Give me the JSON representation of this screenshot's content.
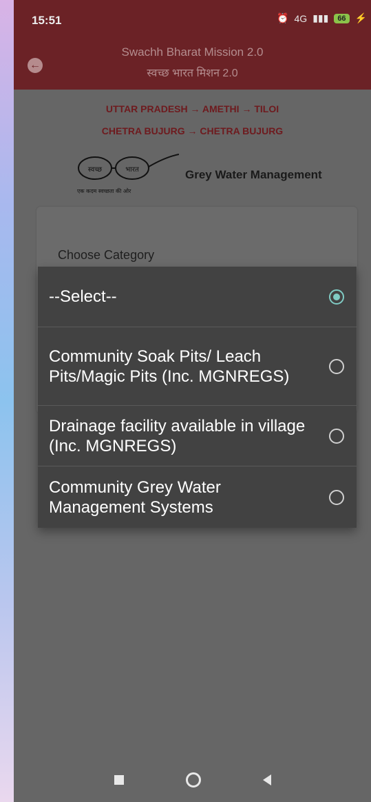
{
  "status": {
    "time": "15:51",
    "network": "4G",
    "battery": "66"
  },
  "header": {
    "title": "Swachh Bharat Mission 2.0",
    "subtitle": "स्वच्छ भारत मिशन 2.0"
  },
  "breadcrumb": {
    "line1": "UTTAR PRADESH → AMETHI → TILOI",
    "line2": "CHETRA BUJURG → CHETRA BUJURG"
  },
  "logo": {
    "word1": "स्वच्छ",
    "word2": "भारत",
    "tagline": "एक कदम स्वच्छता की ओर"
  },
  "section_title": "Grey Water Management",
  "form": {
    "category_label": "Choose Category"
  },
  "dialog": {
    "options": [
      {
        "label": "--Select--",
        "checked": true
      },
      {
        "label": "Community Soak Pits/ Leach Pits/Magic Pits (Inc. MGNREGS)",
        "checked": false
      },
      {
        "label": "Drainage facility available in village (Inc. MGNREGS)",
        "checked": false
      },
      {
        "label": "Community Grey Water Management Systems",
        "checked": false
      }
    ]
  },
  "colors": {
    "appbar": "#6b2226",
    "radio_accent": "#80cbc4",
    "dialog_bg": "#424242"
  }
}
